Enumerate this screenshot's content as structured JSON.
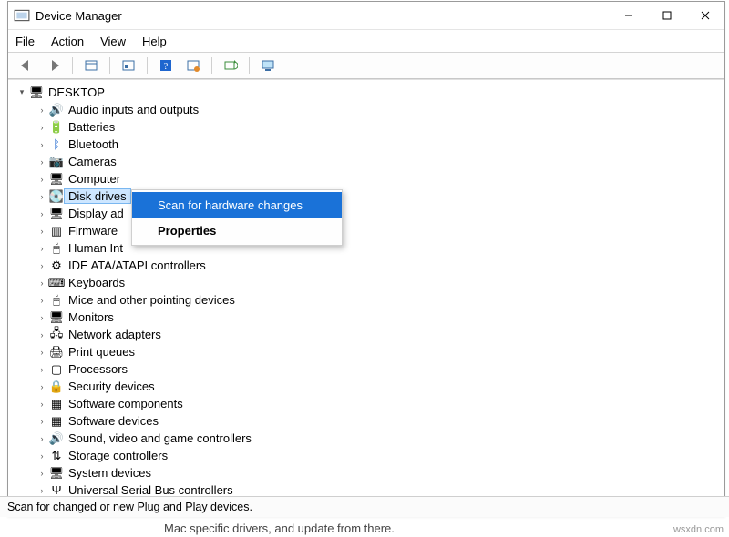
{
  "window": {
    "title": "Device Manager"
  },
  "menu": {
    "file": "File",
    "action": "Action",
    "view": "View",
    "help": "Help"
  },
  "tree": {
    "root": "DESKTOP",
    "items": [
      {
        "label": "Audio inputs and outputs",
        "icon": "🔊"
      },
      {
        "label": "Batteries",
        "icon": "🔋"
      },
      {
        "label": "Bluetooth",
        "icon": "ᛒ",
        "blue": true
      },
      {
        "label": "Cameras",
        "icon": "📷"
      },
      {
        "label": "Computer",
        "icon": "🖥"
      },
      {
        "label": "Disk drives",
        "icon": "💽",
        "selected": true
      },
      {
        "label": "Display adapters",
        "icon": "🖥",
        "cut": "Display ad"
      },
      {
        "label": "Firmware",
        "icon": "▥"
      },
      {
        "label": "Human Interface Devices",
        "icon": "🖱",
        "cut": "Human Int"
      },
      {
        "label": "IDE ATA/ATAPI controllers",
        "icon": "⚙"
      },
      {
        "label": "Keyboards",
        "icon": "⌨"
      },
      {
        "label": "Mice and other pointing devices",
        "icon": "🖱"
      },
      {
        "label": "Monitors",
        "icon": "🖥"
      },
      {
        "label": "Network adapters",
        "icon": "🖧"
      },
      {
        "label": "Print queues",
        "icon": "🖨"
      },
      {
        "label": "Processors",
        "icon": "▢"
      },
      {
        "label": "Security devices",
        "icon": "🔒"
      },
      {
        "label": "Software components",
        "icon": "▦"
      },
      {
        "label": "Software devices",
        "icon": "▦"
      },
      {
        "label": "Sound, video and game controllers",
        "icon": "🔊"
      },
      {
        "label": "Storage controllers",
        "icon": "⇅"
      },
      {
        "label": "System devices",
        "icon": "🖥"
      },
      {
        "label": "Universal Serial Bus controllers",
        "icon": "Ψ"
      }
    ]
  },
  "context_menu": {
    "scan": "Scan for hardware changes",
    "props": "Properties"
  },
  "status": "Scan for changed or new Plug and Play devices.",
  "below": "Mac specific drivers, and update from there.",
  "watermark": "wsxdn.com"
}
